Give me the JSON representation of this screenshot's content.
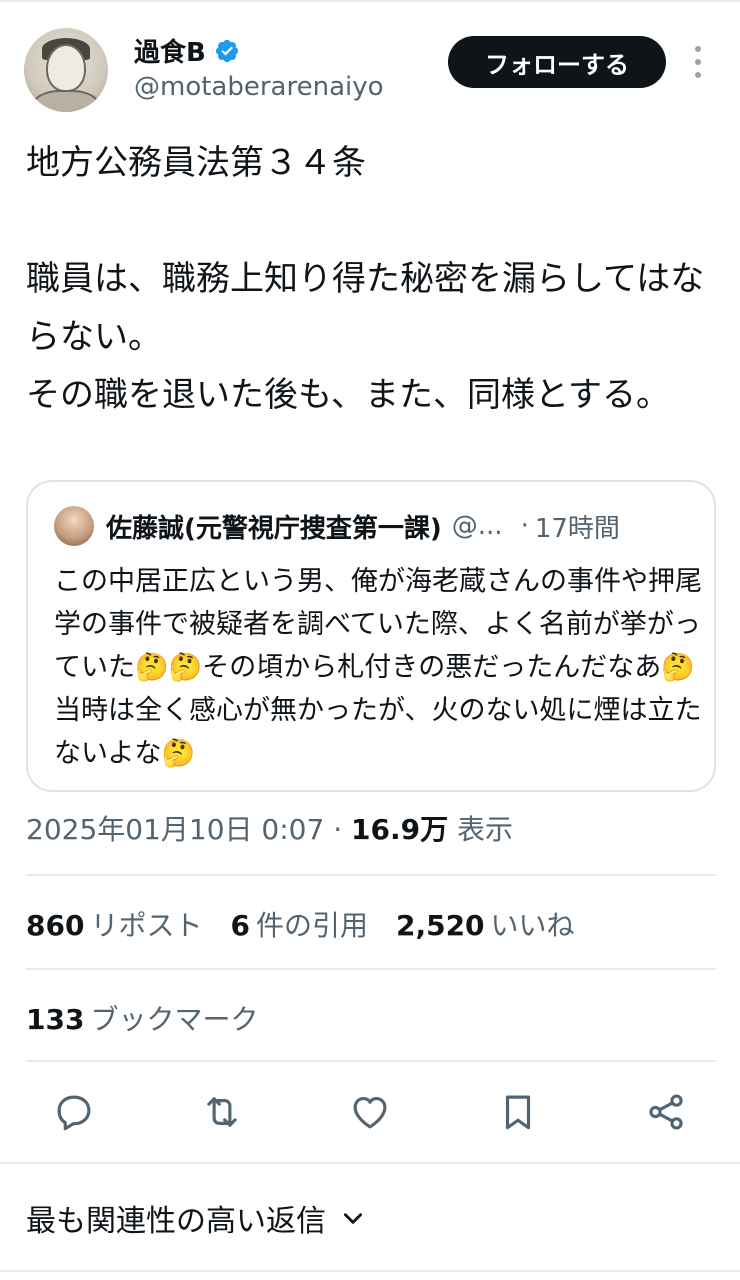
{
  "author": {
    "display_name": "過食B",
    "handle": "@motaberarenaiyo",
    "verified": true,
    "avatar_icon": "sketch-portrait-avatar"
  },
  "header": {
    "follow_label": "フォローする",
    "more_icon": "more-vertical-icon"
  },
  "tweet": {
    "text": "地方公務員法第３４条\n\n職員は、職務上知り得た秘密を漏らしてはならない。\nその職を退いた後も、また、同様とする。"
  },
  "quote": {
    "name": "佐藤誠(元警視庁捜査第一課)",
    "handle": "@...",
    "separator": "·",
    "time": "17時間",
    "text": "この中居正広という男、俺が海老蔵さんの事件や押尾学の事件で被疑者を調べていた際、よく名前が挙がっていた🤔🤔その頃から札付きの悪だったんだなあ🤔当時は全く感心が無かったが、火のない処に煙は立たないよな🤔"
  },
  "meta": {
    "timestamp": "2025年01月10日 0:07",
    "separator": "·",
    "views_count": "16.9万",
    "views_label": "表示"
  },
  "stats": {
    "reposts_count": "860",
    "reposts_label": "リポスト",
    "quotes_count": "6",
    "quotes_label": "件の引用",
    "likes_count": "2,520",
    "likes_label": "いいね",
    "bookmarks_count": "133",
    "bookmarks_label": "ブックマーク"
  },
  "actions": [
    "reply-icon",
    "repost-icon",
    "like-icon",
    "bookmark-icon",
    "share-icon"
  ],
  "replies_sort": {
    "label": "最も関連性の高い返信"
  },
  "colors": {
    "text": "#0f1419",
    "secondary": "#536471",
    "divider": "#e6e9eb",
    "verified": "#1d9bf0",
    "follow_bg": "#0f1419"
  }
}
